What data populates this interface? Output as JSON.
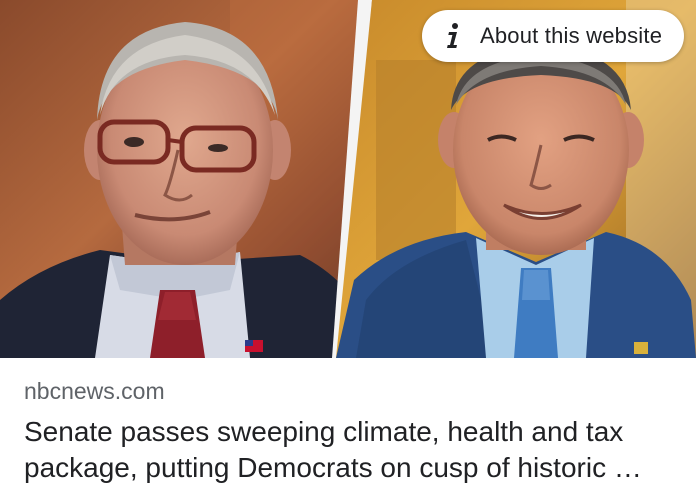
{
  "colors": {
    "pill_background": "#ffffff",
    "pill_text": "#202124",
    "source_text": "#5f6368",
    "headline_text": "#202124"
  },
  "image": {
    "left_icon": "photo-left",
    "right_icon": "photo-right"
  },
  "about_pill": {
    "icon": "info-icon",
    "label": "About this website"
  },
  "article": {
    "source": "nbcnews.com",
    "headline": "Senate passes sweeping climate, health and tax package, putting Democrats on cusp of historic …"
  }
}
